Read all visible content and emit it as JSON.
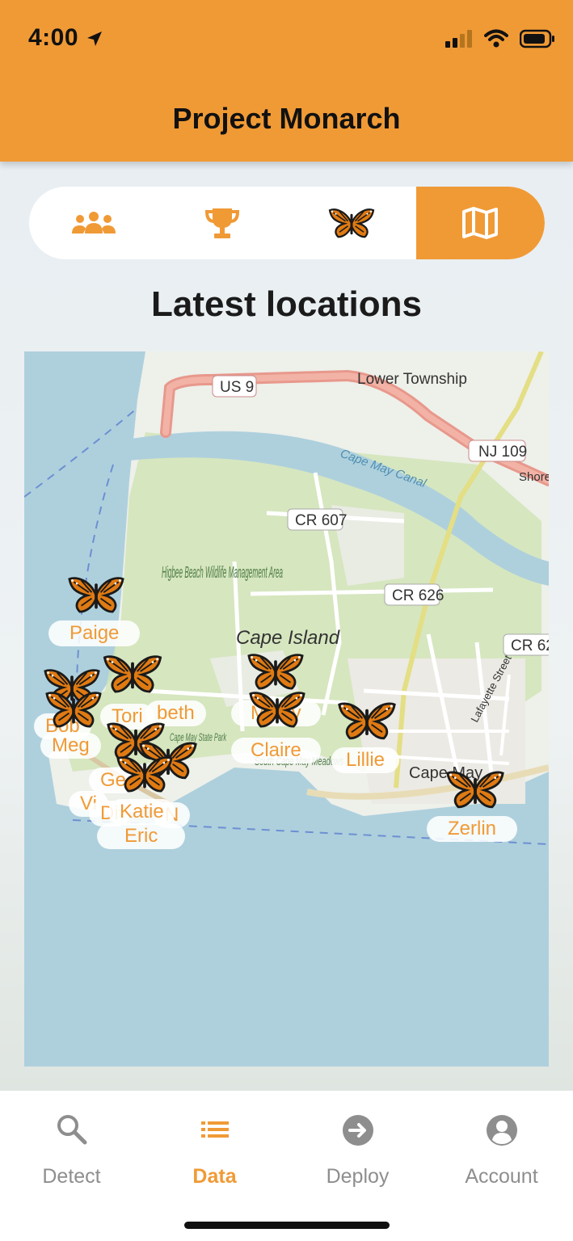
{
  "status": {
    "time": "4:00"
  },
  "header": {
    "title": "Project Monarch"
  },
  "segments": [
    {
      "icon": "group-icon"
    },
    {
      "icon": "trophy-icon"
    },
    {
      "icon": "butterfly-icon"
    },
    {
      "icon": "map-icon",
      "active": true
    }
  ],
  "section": {
    "title": "Latest locations"
  },
  "map": {
    "places": {
      "township": "Lower Township",
      "us9": "US 9",
      "nj109": "NJ 109",
      "shore": "Shore",
      "canal": "Cape May Canal",
      "cr607": "CR 607",
      "cr626": "CR 626",
      "cr62x": "CR 62",
      "higbee": "Higbee Beach Wildlife Management Area",
      "cape_island": "Cape Island",
      "lafayette": "Lafayette Street",
      "capemay_town": "Cape May",
      "meadows": "South Cape May Meadows",
      "state_park": "Cape May State Park"
    },
    "labels": {
      "paige": "Paige",
      "tori": "Tori",
      "beth": "beth",
      "bob": "Bob",
      "meg": "Meg",
      "ge": "Ge",
      "vi": "Vi",
      "di": "Di",
      "katie": "Katie",
      "n": "N",
      "eric": "Eric",
      "mikey": "Mikey",
      "claire": "Claire",
      "lillie": "Lillie",
      "zerlin": "Zerlin"
    }
  },
  "tabs": [
    {
      "label": "Detect",
      "icon": "search-icon"
    },
    {
      "label": "Data",
      "icon": "list-icon",
      "active": true
    },
    {
      "label": "Deploy",
      "icon": "arrow-circle-icon"
    },
    {
      "label": "Account",
      "icon": "account-icon"
    }
  ],
  "colors": {
    "accent": "#f09a36",
    "water": "#aed0dd",
    "land": "#f1efe9",
    "green": "#cfe4b4"
  }
}
